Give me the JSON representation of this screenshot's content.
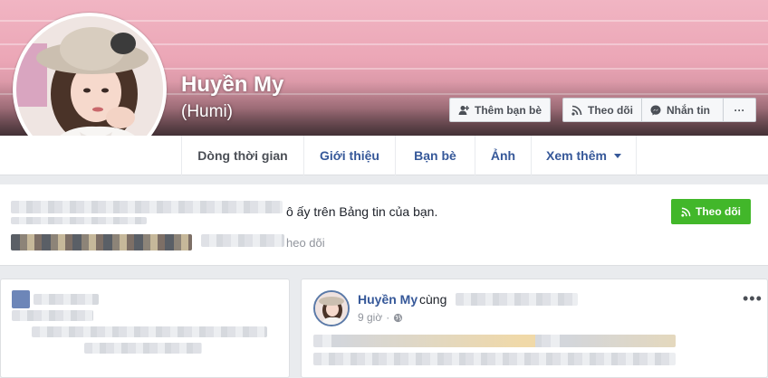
{
  "profile": {
    "name": "Huyền My",
    "alternate_name": "(Humi)"
  },
  "actions": {
    "add_friend": "Thêm bạn bè",
    "follow": "Theo dõi",
    "message": "Nhắn tin",
    "more": "···"
  },
  "tabs": [
    {
      "label": "Dòng thời gian",
      "active": true
    },
    {
      "label": "Giới thiệu"
    },
    {
      "label": "Bạn bè"
    },
    {
      "label": "Ảnh"
    },
    {
      "label": "Xem thêm"
    }
  ],
  "follow_banner": {
    "text": "ô ấy trên Bảng tin của bạn.",
    "subtext": "heo dõi",
    "button": "Theo dõi"
  },
  "post": {
    "author": "Huyền My",
    "with_text": "cùng",
    "time": "9 giờ",
    "menu": "•••"
  },
  "icons": {
    "add_friend": "add-friend-icon",
    "rss": "rss-icon",
    "messenger": "messenger-icon",
    "globe": "globe-icon",
    "caret": "caret-down-icon"
  },
  "colors": {
    "link_blue": "#365899",
    "green": "#42b72a",
    "cover_pink": "#eba6b6"
  }
}
